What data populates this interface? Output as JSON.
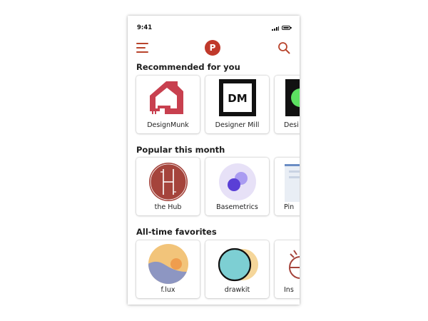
{
  "status_bar": {
    "time": "9:41"
  },
  "header": {
    "logo_letter": "P"
  },
  "sections": [
    {
      "title": "Recommended for you",
      "items": [
        {
          "label": "DesignMunk",
          "icon": "designmunk-logo"
        },
        {
          "label": "Designer Mill",
          "icon": "designer-mill-logo",
          "logo_text": "DM"
        },
        {
          "label": "Desi",
          "icon": "partial-green-logo"
        }
      ]
    },
    {
      "title": "Popular this month",
      "items": [
        {
          "label": "the Hub",
          "icon": "the-hub-logo"
        },
        {
          "label": "Basemetrics",
          "icon": "basemetrics-logo"
        },
        {
          "label": "Pin",
          "icon": "partial-pin-thumbnail"
        }
      ]
    },
    {
      "title": "All-time favorites",
      "items": [
        {
          "label": "f.lux",
          "icon": "flux-logo"
        },
        {
          "label": "drawkit",
          "icon": "drawkit-logo"
        },
        {
          "label": "Ins",
          "icon": "partial-ins-logo"
        }
      ]
    }
  ],
  "colors": {
    "brand": "#c0392b",
    "menu": "#b8442c",
    "designmunk": "#c8404f",
    "hub": "#a5443c",
    "basemetrics_bg": "#e7e1f7",
    "basemetrics_dot": "#5a3fd6",
    "flux_sun": "#f2c47a",
    "flux_hill": "#8d96c2",
    "drawkit_teal": "#7dcfd3",
    "drawkit_yellow": "#f5d69a",
    "green": "#5ce061"
  }
}
